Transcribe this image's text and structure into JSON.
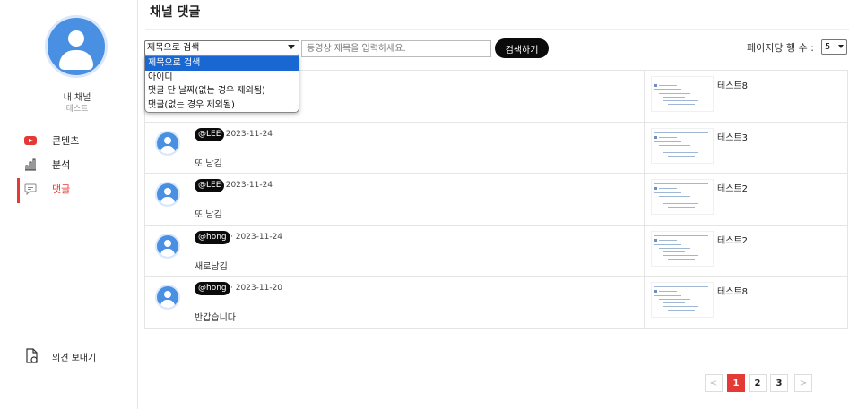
{
  "page": {
    "title": "채널 댓글"
  },
  "sidebar": {
    "channel_name": "내 채널",
    "channel_sub": "테스트",
    "items": [
      {
        "label": "콘텐츠",
        "icon": "youtube-icon"
      },
      {
        "label": "분석",
        "icon": "bar-chart-icon"
      },
      {
        "label": "댓글",
        "icon": "comment-icon",
        "active": true
      }
    ],
    "feedback": {
      "label": "의견 보내기",
      "icon": "document-feedback-icon"
    }
  },
  "toolbar": {
    "search_type_value": "제목으로 검색",
    "search_type_options": [
      "제목으로 검색",
      "아이디",
      "댓글 단 날짜(없는 경우 제외됨)",
      "댓글(없는 경우 제외됨)"
    ],
    "search_placeholder": "동영상 제목을 입력하세요.",
    "search_button": "검색하기",
    "rows_per_page_label": "페이지당 행 수 :",
    "rows_per_page_value": "5"
  },
  "comments": [
    {
      "user": "",
      "date": "",
      "text": "",
      "video_title": "테스트8"
    },
    {
      "user": "@LEE",
      "date": " · 2023-11-24",
      "text": "또 남김",
      "video_title": "테스트3"
    },
    {
      "user": "@LEE",
      "date": " · 2023-11-24",
      "text": "또 남김",
      "video_title": "테스트2"
    },
    {
      "user": "@hong",
      "date": " · 2023-11-24",
      "text": "새로남김",
      "video_title": "테스트2"
    },
    {
      "user": "@hong",
      "date": " · 2023-11-20",
      "text": "반갑습니다",
      "video_title": "테스트8"
    }
  ],
  "pagination": {
    "prev": "<",
    "pages": [
      "1",
      "2",
      "3"
    ],
    "current": "1",
    "next": ">"
  },
  "colors": {
    "accent": "#e53935",
    "avatar": "#4a90e2",
    "select_highlight": "#1967d2"
  }
}
